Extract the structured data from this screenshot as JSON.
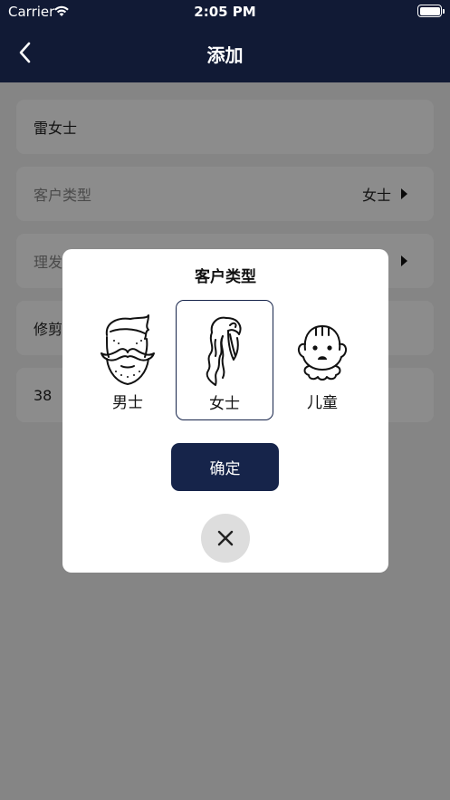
{
  "status_bar": {
    "carrier": "Carrier",
    "time": "2:05 PM"
  },
  "nav": {
    "title": "添加",
    "back_icon": "chevron-left-icon"
  },
  "form": {
    "name_value": "雷女士",
    "customer_type_label": "客户类型",
    "customer_type_value": "女士",
    "hairdresser_label": "理发",
    "trim_label": "修剪",
    "age_value": "38"
  },
  "modal": {
    "title": "客户类型",
    "options": [
      {
        "label": "男士",
        "icon": "man-beard-icon",
        "selected": false
      },
      {
        "label": "女士",
        "icon": "woman-long-hair-icon",
        "selected": true
      },
      {
        "label": "儿童",
        "icon": "child-face-icon",
        "selected": false
      }
    ],
    "confirm_label": "确定",
    "close_icon": "close-icon"
  },
  "colors": {
    "navy": "#111a35",
    "button": "#16244a",
    "overlay": "rgba(0,0,0,0.45)"
  }
}
